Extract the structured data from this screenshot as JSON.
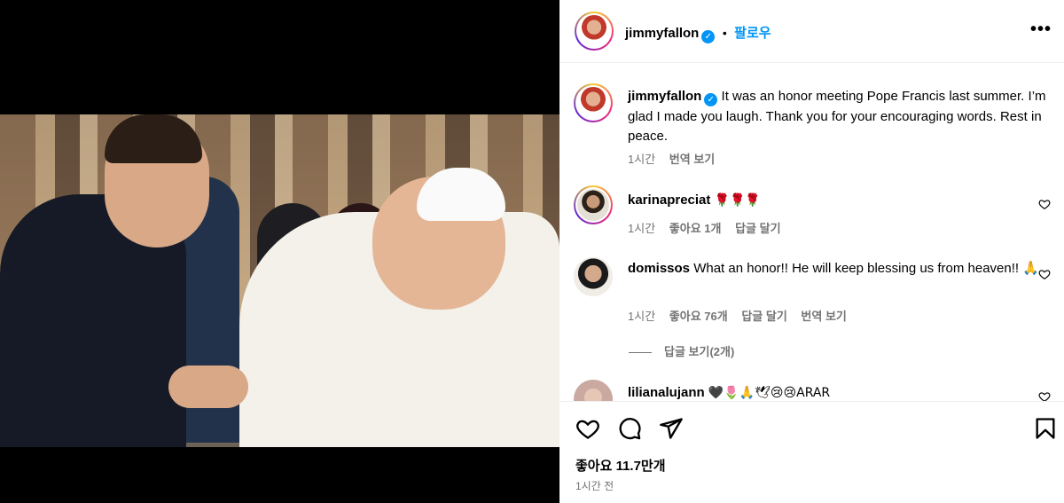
{
  "header": {
    "username": "jimmyfallon",
    "verified": true,
    "follow_label": "팔로우",
    "more": "•••"
  },
  "caption": {
    "username": "jimmyfallon",
    "text": "It was an honor meeting Pope Francis last summer. I’m glad I made you laugh. Thank you for your encouraging words. Rest in peace.",
    "time": "1시간",
    "translate": "번역 보기"
  },
  "comments": [
    {
      "username": "karinapreciat",
      "text": "🌹🌹🌹",
      "time": "1시간",
      "likes": "좋아요 1개",
      "reply": "답글 달기"
    },
    {
      "username": "domissos",
      "text": "What an honor!! He will keep blessing us from heaven!! 🙏",
      "time": "1시간",
      "likes": "좋아요 76개",
      "reply": "답글 달기",
      "translate": "번역 보기",
      "view_replies": "답글 보기(2개)"
    },
    {
      "username": "lilianalujann",
      "text": "🖤🌷🙏🕊😢😢ARAR"
    }
  ],
  "footer": {
    "likes": "좋아요 11.7만개",
    "time": "1시간 전"
  },
  "icons": [
    "heart-icon",
    "comment-icon",
    "share-icon",
    "bookmark-icon",
    "verified-icon",
    "more-icon"
  ],
  "colors": {
    "accent": "#0095f6",
    "muted": "#737373"
  }
}
